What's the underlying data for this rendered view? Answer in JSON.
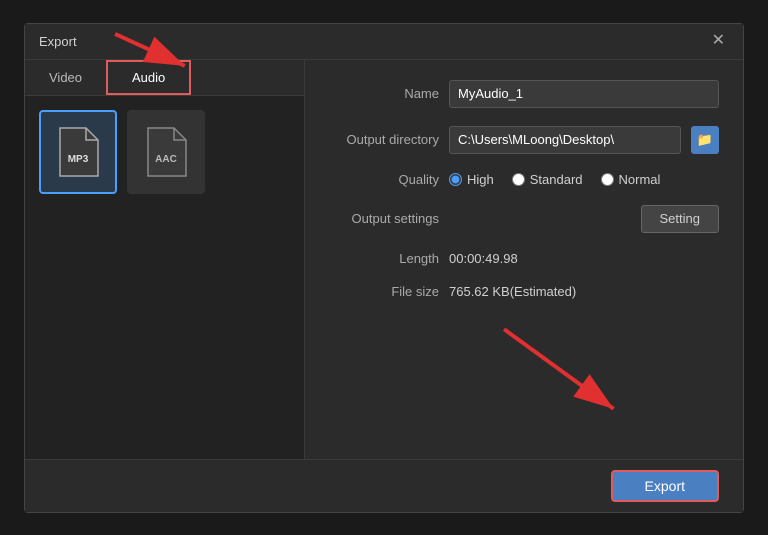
{
  "window": {
    "title": "Export",
    "close_label": "✕"
  },
  "tabs": [
    {
      "id": "video",
      "label": "Video",
      "active": false
    },
    {
      "id": "audio",
      "label": "Audio",
      "active": true
    }
  ],
  "formats": [
    {
      "id": "mp3",
      "label": "MP3",
      "selected": true
    },
    {
      "id": "aac",
      "label": "AAC",
      "selected": false
    }
  ],
  "form": {
    "name_label": "Name",
    "name_value": "MyAudio_1",
    "name_placeholder": "MyAudio_1",
    "dir_label": "Output directory",
    "dir_value": "C:\\Users\\MLoong\\Desktop\\",
    "quality_label": "Quality",
    "quality_options": [
      {
        "id": "high",
        "label": "High",
        "checked": true
      },
      {
        "id": "standard",
        "label": "Standard",
        "checked": false
      },
      {
        "id": "normal",
        "label": "Normal",
        "checked": false
      }
    ],
    "output_settings_label": "Output settings",
    "setting_btn_label": "Setting",
    "length_label": "Length",
    "length_value": "00:00:49.98",
    "filesize_label": "File size",
    "filesize_value": "765.62 KB(Estimated)"
  },
  "footer": {
    "export_label": "Export"
  },
  "icons": {
    "folder": "📁",
    "close": "✕"
  }
}
